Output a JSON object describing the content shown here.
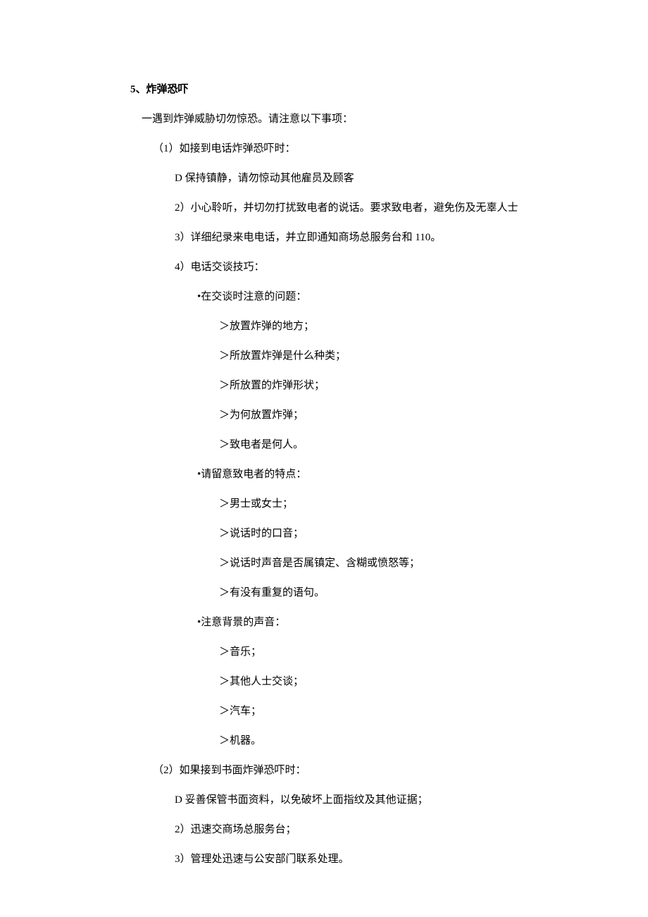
{
  "title": "5、炸弹恐吓",
  "intro": "一遇到炸弹威胁切勿惊恐。请注意以下事项：",
  "s1": {
    "head": "（1）如接到电话炸弹恐吓时：",
    "i1": "D 保持镇静，请勿惊动其他雇员及顾客",
    "i2": "2）小心聆听，并切勿打扰致电者的说话。要求致电者，避免伤及无辜人士",
    "i3": "3）详细纪录来电电话，并立即通知商场总服务台和 110。",
    "i4": "4）电话交谈技巧：",
    "t1": {
      "head": "•在交谈时注意的问题：",
      "l1": "＞放置炸弹的地方；",
      "l2": "＞所放置炸弹是什么种类；",
      "l3": "＞所放置的炸弹形状；",
      "l4": "＞为何放置炸弹；",
      "l5": "＞致电者是何人。"
    },
    "t2": {
      "head": "•请留意致电者的特点：",
      "l1": "＞男士或女士；",
      "l2": "＞说话时的口音；",
      "l3": "＞说话时声音是否属镇定、含糊或愤怒等；",
      "l4": "＞有没有重复的语句。"
    },
    "t3": {
      "head": "•注意背景的声音：",
      "l1": "＞音乐；",
      "l2": "＞其他人士交谈；",
      "l3": "＞汽车；",
      "l4": "＞机器。"
    }
  },
  "s2": {
    "head": "（2）如果接到书面炸弹恐吓时：",
    "i1": "D 妥善保管书面资料，以免破坏上面指纹及其他证据；",
    "i2": "2）迅速交商场总服务台；",
    "i3": "3）管理处迅速与公安部门联系处理。"
  }
}
